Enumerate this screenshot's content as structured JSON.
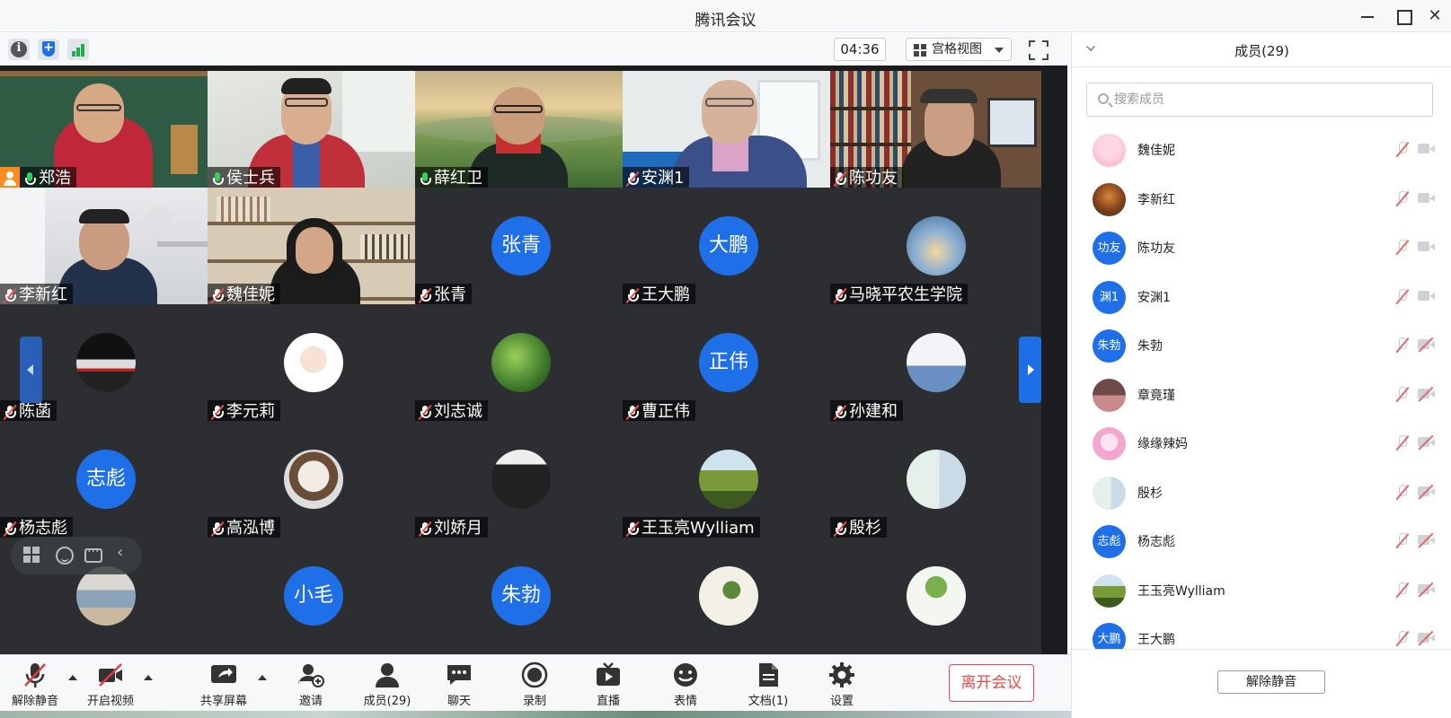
{
  "window": {
    "title": "腾讯会议"
  },
  "toolbar": {
    "timer": "04:36",
    "view_mode": "宫格视图"
  },
  "tiles": [
    {
      "name": "郑浩",
      "mic": "on",
      "host": true,
      "kind": "video",
      "scene": "chalkboard"
    },
    {
      "name": "侯士兵",
      "mic": "on",
      "kind": "video",
      "scene": "office",
      "active": true
    },
    {
      "name": "薛红卫",
      "mic": "on",
      "kind": "video",
      "scene": "landscape"
    },
    {
      "name": "安渊1",
      "mic": "muted",
      "kind": "video",
      "scene": "room"
    },
    {
      "name": "陈功友",
      "mic": "muted",
      "kind": "video",
      "scene": "bookshelf"
    },
    {
      "name": "李新红",
      "mic": "muted",
      "kind": "video",
      "scene": "whiteroom"
    },
    {
      "name": "魏佳妮",
      "mic": "muted",
      "kind": "video",
      "scene": "shelf"
    },
    {
      "name": "张青",
      "mic": "muted",
      "kind": "avatar",
      "avatar_text": "张青"
    },
    {
      "name": "王大鹏",
      "mic": "muted",
      "kind": "avatar",
      "avatar_text": "大鹏"
    },
    {
      "name": "马晓平农生学院",
      "mic": "muted",
      "kind": "pic",
      "pic": "sky"
    },
    {
      "name": "陈菡",
      "mic": "muted",
      "kind": "pic",
      "pic": "train"
    },
    {
      "name": "李元莉",
      "mic": "muted",
      "kind": "pic",
      "pic": "cartoon"
    },
    {
      "name": "刘志诚",
      "mic": "muted",
      "kind": "pic",
      "pic": "plant"
    },
    {
      "name": "曹正伟",
      "mic": "muted",
      "kind": "avatar",
      "avatar_text": "正伟"
    },
    {
      "name": "孙建和",
      "mic": "muted",
      "kind": "pic",
      "pic": "poster"
    },
    {
      "name": "杨志彪",
      "mic": "muted",
      "kind": "avatar",
      "avatar_text": "志彪"
    },
    {
      "name": "高泓博",
      "mic": "muted",
      "kind": "pic",
      "pic": "dog"
    },
    {
      "name": "刘娇月",
      "mic": "muted",
      "kind": "pic",
      "pic": "girl"
    },
    {
      "name": "王玉亮Wylliam",
      "mic": "muted",
      "kind": "pic",
      "pic": "field"
    },
    {
      "name": "殷杉",
      "mic": "muted",
      "kind": "pic",
      "pic": "person"
    },
    {
      "name": "",
      "mic": "none",
      "kind": "pic",
      "pic": "boats"
    },
    {
      "name": "",
      "mic": "none",
      "kind": "avatar",
      "avatar_text": "小毛"
    },
    {
      "name": "",
      "mic": "none",
      "kind": "avatar",
      "avatar_text": "朱勃"
    },
    {
      "name": "",
      "mic": "none",
      "kind": "pic",
      "pic": "doodle"
    },
    {
      "name": "",
      "mic": "none",
      "kind": "pic",
      "pic": "pot"
    }
  ],
  "controls": [
    {
      "label": "解除静音",
      "icon": "mic-muted-icon"
    },
    {
      "label": "开启视频",
      "icon": "camera-off-icon"
    },
    {
      "label": "共享屏幕",
      "icon": "share-screen-icon"
    },
    {
      "label": "邀请",
      "icon": "invite-icon"
    },
    {
      "label": "成员(29)",
      "icon": "members-icon"
    },
    {
      "label": "聊天",
      "icon": "chat-icon"
    },
    {
      "label": "录制",
      "icon": "record-icon"
    },
    {
      "label": "直播",
      "icon": "live-icon"
    },
    {
      "label": "表情",
      "icon": "emoji-icon"
    },
    {
      "label": "文档(1)",
      "icon": "document-icon"
    },
    {
      "label": "设置",
      "icon": "settings-icon"
    }
  ],
  "leave_label": "离开会议",
  "panel": {
    "title": "成员(29)",
    "search_placeholder": "搜索成员",
    "unmute_all": "解除静音",
    "members": [
      {
        "name": "魏佳妮",
        "avatar": "pic",
        "pic": "pink",
        "cam": "on"
      },
      {
        "name": "李新红",
        "avatar": "pic",
        "pic": "autumn",
        "cam": "on"
      },
      {
        "name": "陈功友",
        "avatar": "text",
        "text": "功友",
        "cam": "on"
      },
      {
        "name": "安渊1",
        "avatar": "text",
        "text": "渊1",
        "cam": "on"
      },
      {
        "name": "朱勃",
        "avatar": "text",
        "text": "朱勃",
        "cam": "off"
      },
      {
        "name": "章竟瑾",
        "avatar": "pic",
        "pic": "girl2",
        "cam": "off"
      },
      {
        "name": "缘缘辣妈",
        "avatar": "pic",
        "pic": "anime",
        "cam": "off"
      },
      {
        "name": "殷杉",
        "avatar": "pic",
        "pic": "person",
        "cam": "off"
      },
      {
        "name": "杨志彪",
        "avatar": "text",
        "text": "志彪",
        "cam": "off"
      },
      {
        "name": "王玉亮Wylliam",
        "avatar": "pic",
        "pic": "field",
        "cam": "off"
      },
      {
        "name": "王大鹏",
        "avatar": "text",
        "text": "大鹏",
        "cam": "off"
      }
    ]
  },
  "colors": {
    "accent": "#1f6fe8",
    "leave": "#e84a4a",
    "active_speaker": "#2fbd4e"
  }
}
